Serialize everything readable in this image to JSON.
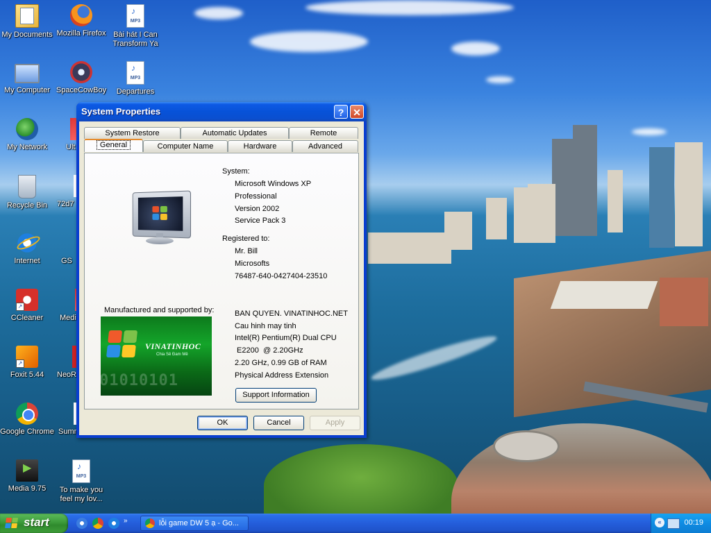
{
  "desktop": {
    "icons": [
      {
        "label": "My Documents"
      },
      {
        "label": "Mozilla Firefox"
      },
      {
        "label": "Bài hát I Can Transform Ya"
      },
      {
        "label": "My Computer"
      },
      {
        "label": "SpaceCowBoy"
      },
      {
        "label": "Departures"
      },
      {
        "label": "My Network"
      },
      {
        "label": "Ult"
      },
      {
        "label": "Recycle Bin"
      },
      {
        "label": "72d7"
      },
      {
        "label": "Internet"
      },
      {
        "label": "GS"
      },
      {
        "label": "CCleaner"
      },
      {
        "label": "Media"
      },
      {
        "label": "Foxit 5.44"
      },
      {
        "label": "NeoR"
      },
      {
        "label": "Google Chrome"
      },
      {
        "label": "Summ"
      },
      {
        "label": "Media 9.75"
      },
      {
        "label": "To make you feel my lov..."
      }
    ],
    "mp3_badge": "MP3"
  },
  "window": {
    "title": "System Properties",
    "help_glyph": "?",
    "close_glyph": "✕",
    "tabs_row1": [
      "System Restore",
      "Automatic Updates",
      "Remote"
    ],
    "tabs_row2": [
      "General",
      "Computer Name",
      "Hardware",
      "Advanced"
    ],
    "active_tab": "General",
    "system": {
      "heading": "System:",
      "lines": [
        "Microsoft Windows XP",
        "Professional",
        "Version 2002",
        "Service Pack 3"
      ]
    },
    "registered": {
      "heading": "Registered to:",
      "lines": [
        "Mr. Bill",
        "Microsofts",
        "76487-640-0427404-23510"
      ]
    },
    "manufacturer": {
      "heading": "Manufactured and supported by:",
      "lines": [
        "BAN QUYEN. VINATINHOC.NET",
        "Cau hinh may tinh",
        "Intel(R) Pentium(R) Dual  CPU",
        " E2200  @ 2.20GHz",
        "2.20 GHz, 0.99 GB of RAM",
        "Physical Address Extension"
      ],
      "logo_brand": "VINATINHOC",
      "logo_tagline": "Chia Sẻ Đam Mê",
      "logo_binary": "01010101"
    },
    "support_button": "Support Information",
    "ok_button": "OK",
    "cancel_button": "Cancel",
    "apply_button": "Apply"
  },
  "taskbar": {
    "start_label": "start",
    "task_button": "lỗi game DW 5 ạ - Go...",
    "clock": "00:19",
    "tray_arrow": "«"
  },
  "colors": {
    "xp_blue": "#0a4fd0",
    "start_green": "#3c9b3a",
    "active_tab_accent": "#e68b2c"
  }
}
